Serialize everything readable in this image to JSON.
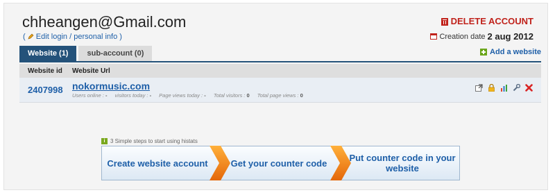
{
  "account": {
    "email": "chheangen@Gmail.com",
    "edit_paren_open": "(",
    "edit_link": "Edit login / personal info",
    "edit_paren_close": ")",
    "delete_label": "DELETE ACCOUNT",
    "creation_label": "Creation date",
    "creation_date": "2 aug 2012"
  },
  "tabs": [
    {
      "label": "Website (1)",
      "active": true
    },
    {
      "label": "sub-account (0)",
      "active": false
    }
  ],
  "add_website": "Add a website",
  "table": {
    "headers": [
      "Website id",
      "Website Url"
    ],
    "rows": [
      {
        "id": "2407998",
        "url": "nokormusic.com",
        "users_online_label": "Users online :",
        "users_online": "-",
        "visitors_today_label": "visitors today :",
        "visitors_today": "-",
        "page_views_today_label": "Page views today :",
        "page_views_today": "-",
        "total_visitors_label": "Total visitors :",
        "total_visitors": "0",
        "total_page_views_label": "Total page views :",
        "total_page_views": "0"
      }
    ]
  },
  "row_actions": [
    "external-link-icon",
    "lock-icon",
    "chart-icon",
    "wrench-icon",
    "delete-icon"
  ],
  "steps": {
    "title": "3 Simple steps to start using histats",
    "info_glyph": "i",
    "items": [
      "Create website account",
      "Get your counter code",
      "Put counter code in your website"
    ]
  },
  "colors": {
    "brand_blue": "#1e5fa8",
    "tab_active": "#24527a",
    "danger": "#c0221b",
    "arrow_orange": "#f07a12",
    "add_green": "#6aa51a"
  }
}
